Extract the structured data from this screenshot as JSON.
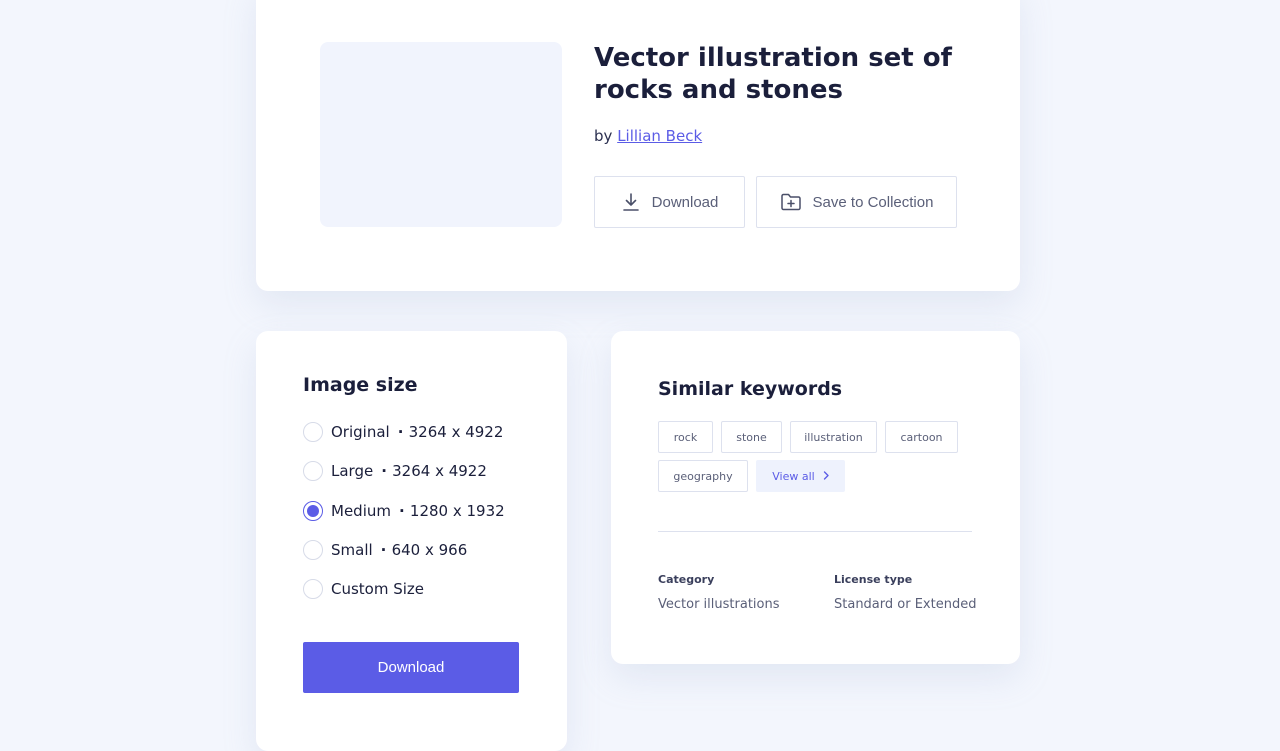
{
  "asset": {
    "title": "Vector illustration set of rocks and stones",
    "by_prefix": "by",
    "author": "Lillian Beck",
    "download_label": "Download",
    "save_label": "Save to Collection"
  },
  "image_size": {
    "heading": "Image size",
    "options": [
      {
        "label": "Original",
        "dimensions": "3264 x 4922",
        "selected": false
      },
      {
        "label": "Large",
        "dimensions": "3264 x 4922",
        "selected": false
      },
      {
        "label": "Medium",
        "dimensions": "1280 x 1932",
        "selected": true
      },
      {
        "label": "Small",
        "dimensions": "640 x 966",
        "selected": false
      },
      {
        "label": "Custom Size",
        "dimensions": "",
        "selected": false
      }
    ],
    "download_label": "Download"
  },
  "keywords": {
    "heading": "Similar keywords",
    "tags": [
      "rock",
      "stone",
      "illustration",
      "cartoon",
      "geography"
    ],
    "view_all_label": "View all",
    "category_label": "Category",
    "category_value": "Vector illustrations",
    "license_label": "License type",
    "license_value": "Standard or Extended"
  },
  "colors": {
    "accent": "#5b5ce6",
    "background": "#f3f6fd",
    "text_dark": "#1b1f3b"
  },
  "icons": [
    "download-icon",
    "folder-plus-icon",
    "chevron-right-icon"
  ]
}
